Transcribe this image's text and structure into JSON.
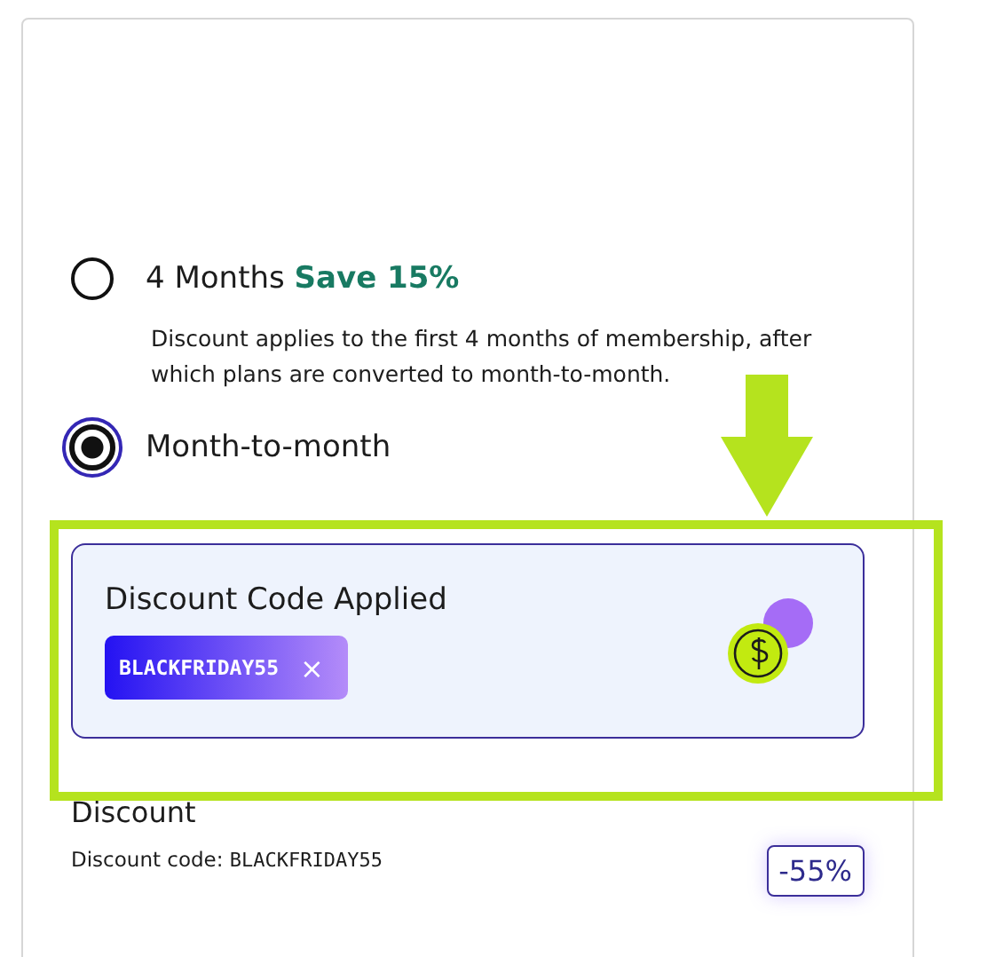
{
  "plans": [
    {
      "label": "4 Months",
      "save": "Save 15%",
      "description": "Discount applies to the first 4 months of membership, after which plans are converted to month-to-month.",
      "selected": false
    },
    {
      "label": "Month-to-month",
      "selected": true
    }
  ],
  "applied_code": {
    "title": "Discount Code Applied",
    "code": "BLACKFRIDAY55",
    "remove": "×"
  },
  "discount": {
    "heading": "Discount",
    "label": "Discount code:",
    "code": "BLACKFRIDAY55",
    "amount": "-55%"
  }
}
